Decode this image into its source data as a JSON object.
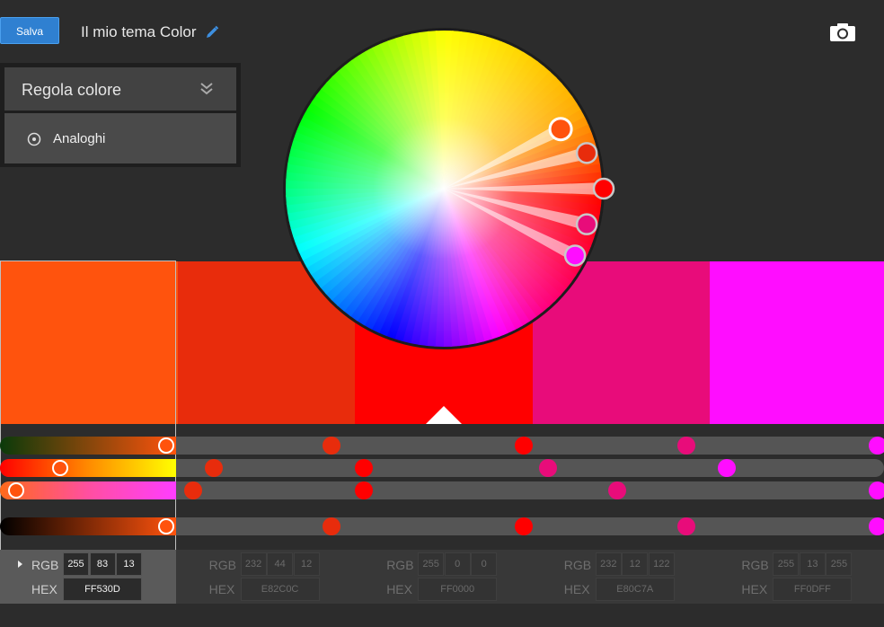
{
  "header": {
    "save_label": "Salva",
    "theme_name": "Il mio tema Color"
  },
  "panel": {
    "title": "Regola colore",
    "rule": "Analoghi"
  },
  "swatches": [
    {
      "hex": "#FF530D",
      "rgb": [
        255,
        83,
        13
      ],
      "hex_label": "FF530D",
      "selected": true
    },
    {
      "hex": "#E82C0C",
      "rgb": [
        232,
        44,
        12
      ],
      "hex_label": "E82C0C",
      "selected": false
    },
    {
      "hex": "#FF0000",
      "rgb": [
        255,
        0,
        0
      ],
      "hex_label": "FF0000",
      "selected": false
    },
    {
      "hex": "#E80C7A",
      "rgb": [
        232,
        12,
        122
      ],
      "hex_label": "E80C7A",
      "selected": false
    },
    {
      "hex": "#FF0DFF",
      "rgb": [
        255,
        13,
        255
      ],
      "hex_label": "FF0DFF",
      "selected": false
    }
  ],
  "color_fields": {
    "rgb_label": "RGB",
    "hex_label": "HEX"
  },
  "icons": {
    "edit": "pencil-icon",
    "capture": "camera-icon",
    "collapse": "double-chevron-down-icon",
    "rule": "radio-circle-icon",
    "expand": "triangle-right-icon"
  }
}
